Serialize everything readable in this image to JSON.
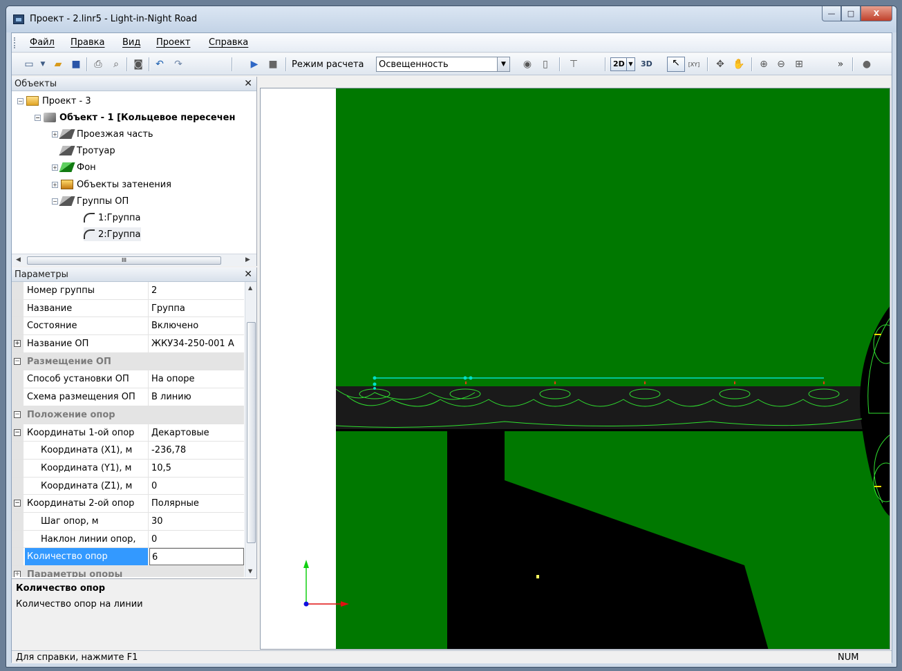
{
  "window": {
    "title": "Проект - 2.linr5 - Light-in-Night Road",
    "controls": {
      "minimize": "—",
      "maximize": "□",
      "close": "X"
    }
  },
  "menu": [
    "Файл",
    "Правка",
    "Вид",
    "Проект",
    "Справка"
  ],
  "toolbar": {
    "mode_label": "Режим расчета",
    "mode_value": "Освещенность",
    "view_2d": "2D",
    "view_3d": "3D",
    "xy_label": "[XY]",
    "icons": [
      "new-file-icon",
      "open-folder-icon",
      "save-icon",
      "print-icon",
      "print-preview-icon",
      "camera-icon",
      "undo-icon",
      "redo-icon",
      "play-icon",
      "stop-icon",
      "eye-icon",
      "page-icon",
      "lamp-icon",
      "select-arrow-icon",
      "select-xy-icon",
      "move-node-icon",
      "hand-pan-icon",
      "zoom-in-icon",
      "zoom-out-icon",
      "zoom-fit-icon",
      "overflow-icon",
      "help-globe-icon"
    ]
  },
  "objects_panel": {
    "title": "Объекты",
    "close": "✕",
    "tree": [
      {
        "label": "Проект - 3"
      },
      {
        "label": "Объект - 1 [Кольцевое пересечен"
      },
      {
        "label": "Проезжая часть"
      },
      {
        "label": "Тротуар"
      },
      {
        "label": "Фон"
      },
      {
        "label": "Объекты затенения"
      },
      {
        "label": "Группы ОП"
      },
      {
        "label": "1:Группа"
      },
      {
        "label": "2:Группа"
      }
    ],
    "hscroll_thumb": "III"
  },
  "params_panel": {
    "title": "Параметры",
    "close": "✕",
    "rows": [
      {
        "name": "Номер группы",
        "value": "2"
      },
      {
        "name": "Название",
        "value": "Группа"
      },
      {
        "name": "Состояние",
        "value": "Включено"
      },
      {
        "name": "Название ОП",
        "value": "ЖКУ34-250-001 А",
        "expander": "+"
      },
      {
        "name": "Размещение ОП",
        "expander": "−"
      },
      {
        "name": "Способ установки ОП",
        "value": "На опоре"
      },
      {
        "name": "Схема размещения ОП",
        "value": "В линию"
      },
      {
        "name": "Положение опор",
        "expander": "−"
      },
      {
        "name": "Координаты 1-ой опор",
        "value": "Декартовые",
        "expander": "−"
      },
      {
        "name": "Координата (X1), м",
        "value": "-236,78"
      },
      {
        "name": "Координата (Y1), м",
        "value": "10,5"
      },
      {
        "name": "Координата (Z1), м",
        "value": "0"
      },
      {
        "name": "Координаты 2-ой опор",
        "value": "Полярные",
        "expander": "−"
      },
      {
        "name": "Шаг опор, м",
        "value": "30"
      },
      {
        "name": "Наклон линии опор,",
        "value": "0"
      },
      {
        "name": "Количество опор",
        "value": "6"
      },
      {
        "name": "Параметры опоры",
        "expander": "+"
      }
    ],
    "help_title": "Количество опор",
    "help_text": "Количество опор на линии"
  },
  "status": {
    "text": "Для справки, нажмите F1",
    "num": "NUM"
  },
  "colors": {
    "background_green": "#007800",
    "road_black": "#000000",
    "pole_line": "#00e0c8",
    "isolines": "#2fe02f",
    "axis_x": "#e01010",
    "axis_y": "#10d010",
    "origin": "#1010e0"
  }
}
